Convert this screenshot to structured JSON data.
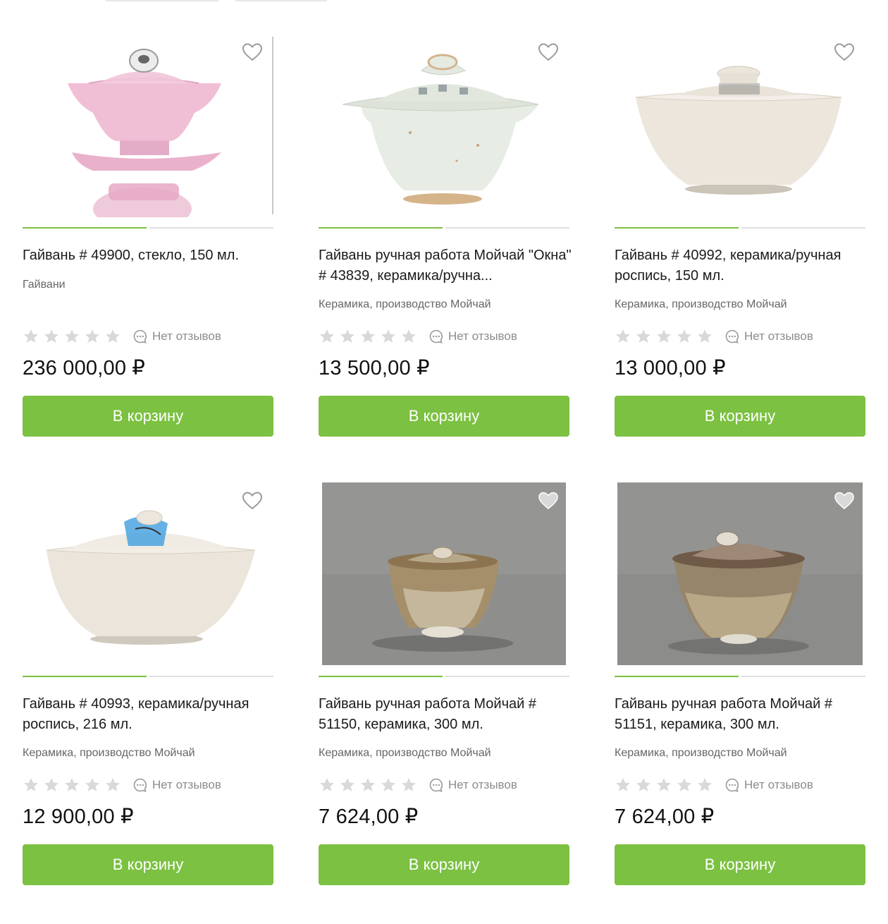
{
  "colors": {
    "accent": "#7cc142",
    "muted": "#8c8c8c",
    "star_empty": "#d9d9d9"
  },
  "products": [
    {
      "title": "Гайвань # 49900, стекло, 150 мл.",
      "category": "Гайвани",
      "rating_stars": 0,
      "reviews_label": "Нет отзывов",
      "price": "236 000,00 ₽",
      "cart_label": "В корзину",
      "image_icon": "glass-gaiwan-photo",
      "favorite_icon": "heart-outline-icon"
    },
    {
      "title": "Гайвань ручная работа Мойчай \"Окна\" # 43839, керамика/ручна...",
      "category": "Керамика, производство Мойчай",
      "rating_stars": 0,
      "reviews_label": "Нет отзывов",
      "price": "13 500,00 ₽",
      "cart_label": "В корзину",
      "image_icon": "celadon-gaiwan-photo",
      "favorite_icon": "heart-outline-icon"
    },
    {
      "title": "Гайвань # 40992, керамика/ручная роспись, 150 мл.",
      "category": "Керамика, производство Мойчай",
      "rating_stars": 0,
      "reviews_label": "Нет отзывов",
      "price": "13 000,00 ₽",
      "cart_label": "В корзину",
      "image_icon": "white-gaiwan-photo",
      "favorite_icon": "heart-outline-icon"
    },
    {
      "title": "Гайвань # 40993, керамика/ручная роспись, 216 мл.",
      "category": "Керамика, производство Мойчай",
      "rating_stars": 0,
      "reviews_label": "Нет отзывов",
      "price": "12 900,00 ₽",
      "cart_label": "В корзину",
      "image_icon": "painted-gaiwan-photo",
      "favorite_icon": "heart-outline-icon"
    },
    {
      "title": "Гайвань ручная работа Мойчай # 51150, керамика, 300 мл.",
      "category": "Керамика, производство Мойчай",
      "rating_stars": 0,
      "reviews_label": "Нет отзывов",
      "price": "7 624,00 ₽",
      "cart_label": "В корзину",
      "image_icon": "wood-fired-gaiwan-photo",
      "favorite_icon": "heart-filled-icon"
    },
    {
      "title": "Гайвань ручная работа Мойчай # 51151, керамика, 300 мл.",
      "category": "Керамика, производство Мойчай",
      "rating_stars": 0,
      "reviews_label": "Нет отзывов",
      "price": "7 624,00 ₽",
      "cart_label": "В корзину",
      "image_icon": "wood-fired-gaiwan-photo",
      "favorite_icon": "heart-filled-icon"
    }
  ]
}
